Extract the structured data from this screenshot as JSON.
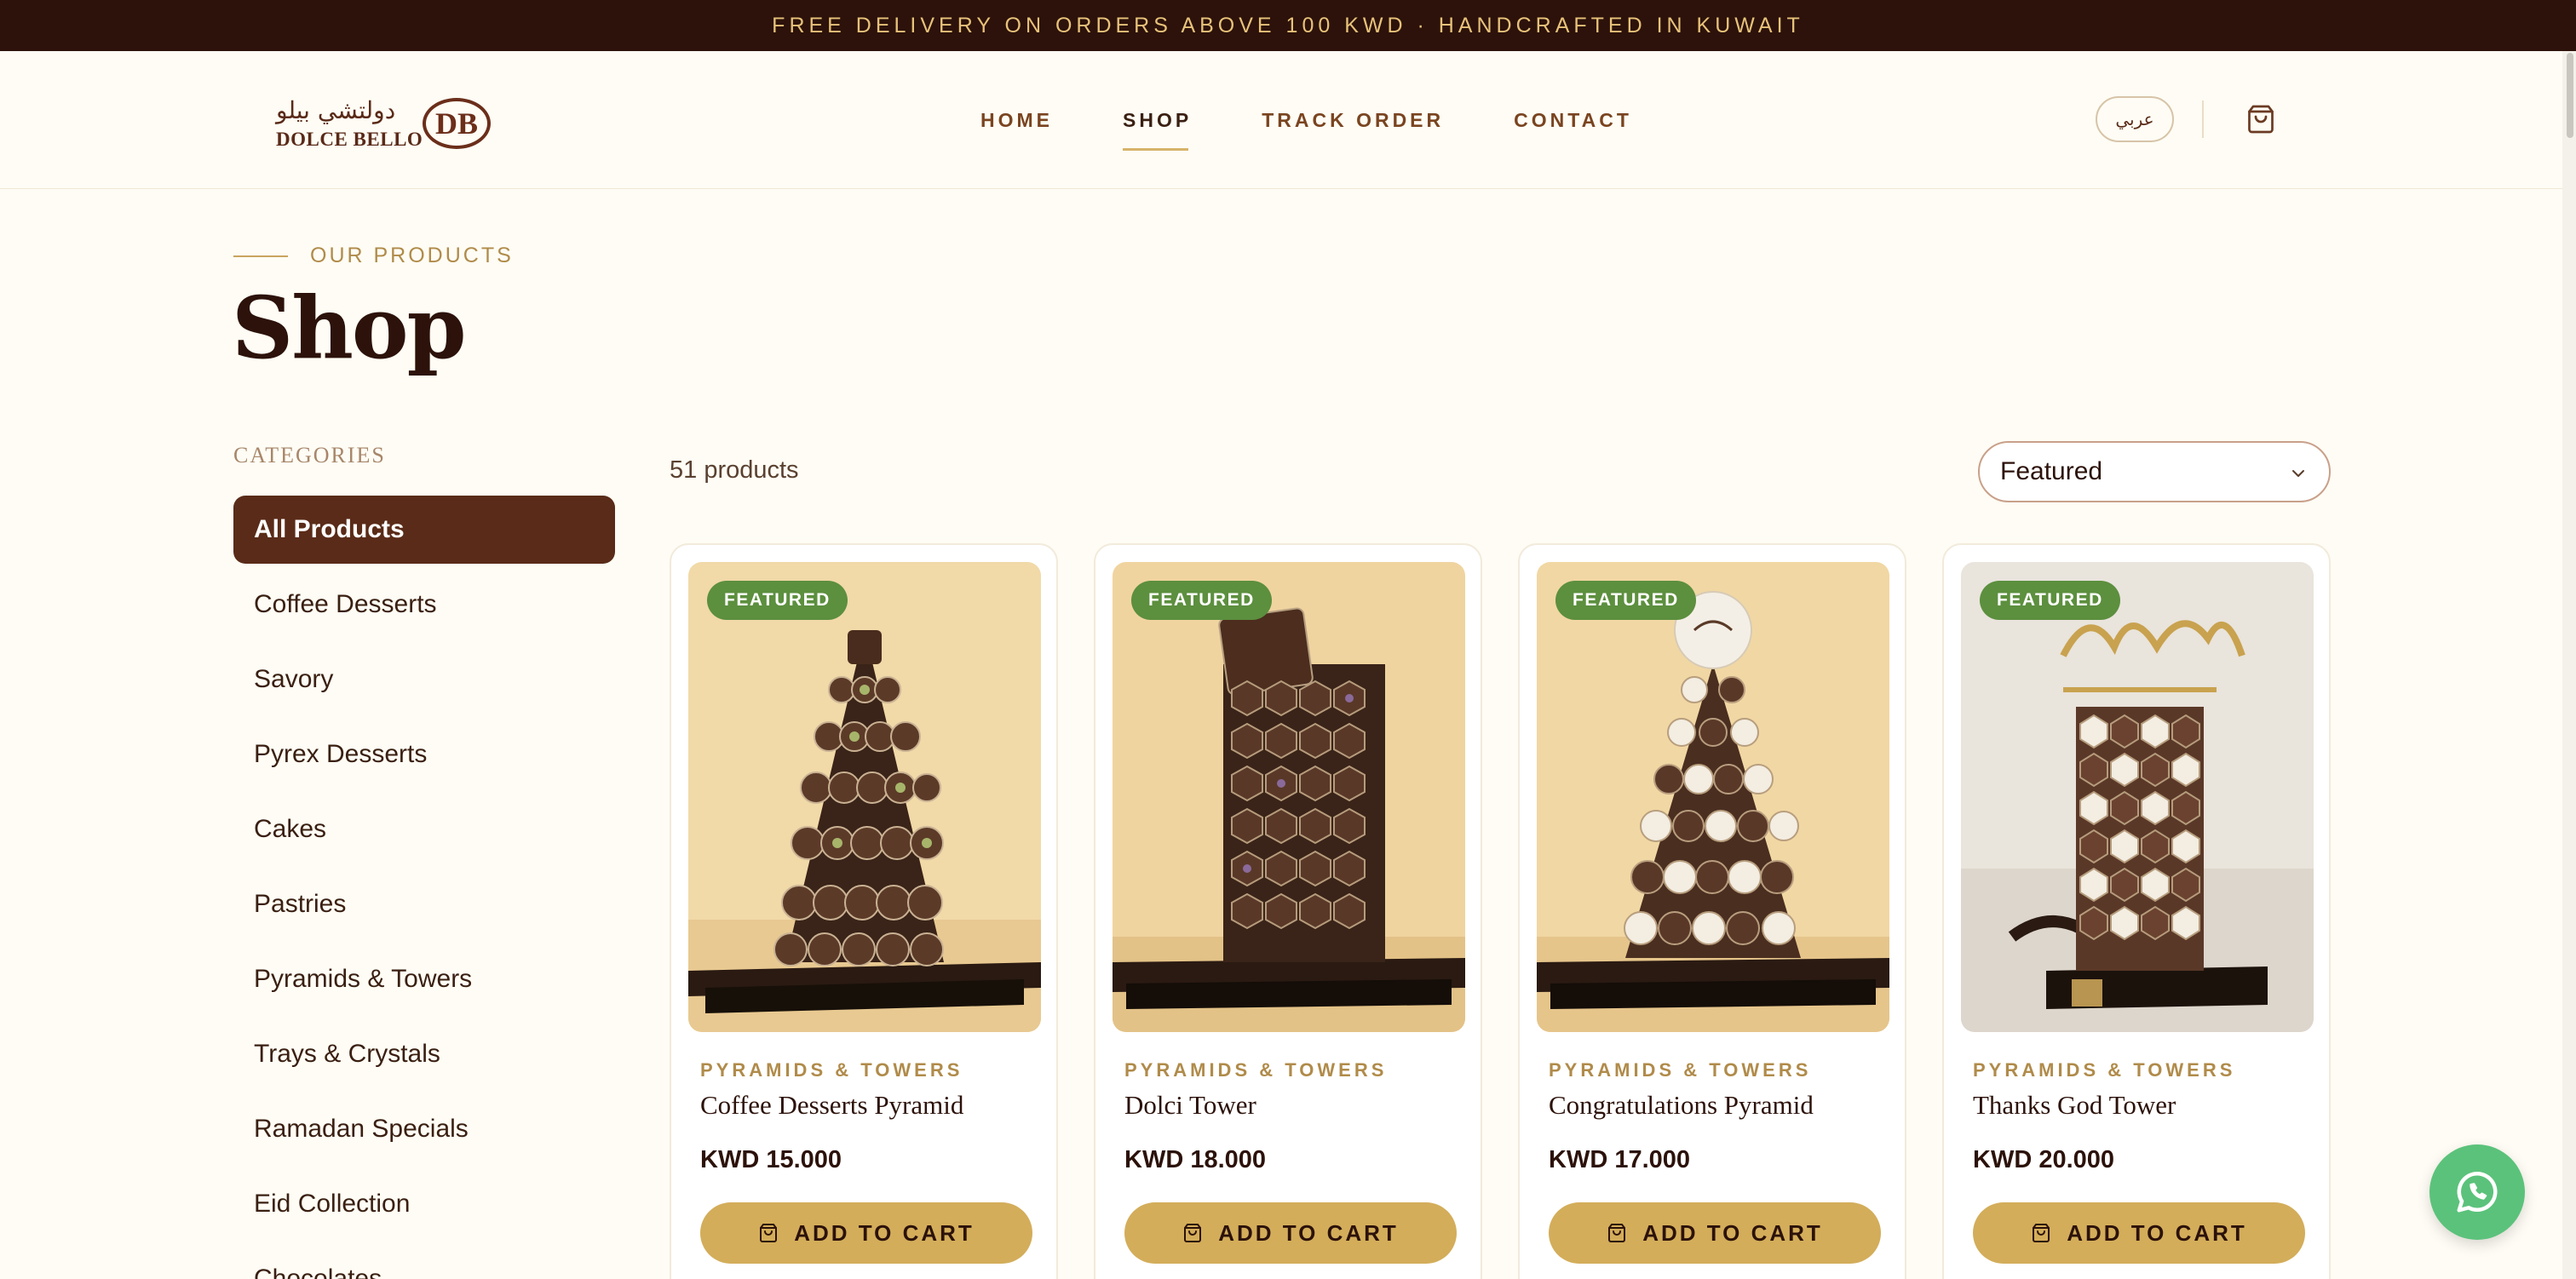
{
  "announcement": "FREE DELIVERY ON ORDERS ABOVE 100 KWD · HANDCRAFTED IN KUWAIT",
  "brand": {
    "arabic": "دولتشي بيلو",
    "english": "DOLCE BELLO",
    "monogram": "DB"
  },
  "nav": [
    {
      "label": "HOME",
      "active": false
    },
    {
      "label": "SHOP",
      "active": true
    },
    {
      "label": "TRACK ORDER",
      "active": false
    },
    {
      "label": "CONTACT",
      "active": false
    }
  ],
  "language_toggle": "عربي",
  "hero": {
    "eyebrow": "OUR PRODUCTS",
    "title": "Shop"
  },
  "categories": {
    "heading": "CATEGORIES",
    "items": [
      {
        "label": "All Products",
        "active": true
      },
      {
        "label": "Coffee Desserts"
      },
      {
        "label": "Savory"
      },
      {
        "label": "Pyrex Desserts"
      },
      {
        "label": "Cakes"
      },
      {
        "label": "Pastries"
      },
      {
        "label": "Pyramids & Towers"
      },
      {
        "label": "Trays & Crystals"
      },
      {
        "label": "Ramadan Specials"
      },
      {
        "label": "Eid Collection"
      },
      {
        "label": "Chocolates"
      }
    ]
  },
  "toolbar": {
    "count": "51 products",
    "sort_value": "Featured"
  },
  "products": [
    {
      "badge": "FEATURED",
      "category": "PYRAMIDS & TOWERS",
      "name": "Coffee Desserts Pyramid",
      "price": "KWD 15.000",
      "button": "ADD TO CART"
    },
    {
      "badge": "FEATURED",
      "category": "PYRAMIDS & TOWERS",
      "name": "Dolci Tower",
      "price": "KWD 18.000",
      "button": "ADD TO CART"
    },
    {
      "badge": "FEATURED",
      "category": "PYRAMIDS & TOWERS",
      "name": "Congratulations Pyramid",
      "price": "KWD 17.000",
      "button": "ADD TO CART"
    },
    {
      "badge": "FEATURED",
      "category": "PYRAMIDS & TOWERS",
      "name": "Thanks God Tower",
      "price": "KWD 20.000",
      "button": "ADD TO CART"
    }
  ],
  "colors": {
    "brand_brown": "#5a2b18",
    "gold": "#d3ad5a",
    "badge_green": "#5c8f3e",
    "whatsapp_green": "#5bc27b"
  }
}
